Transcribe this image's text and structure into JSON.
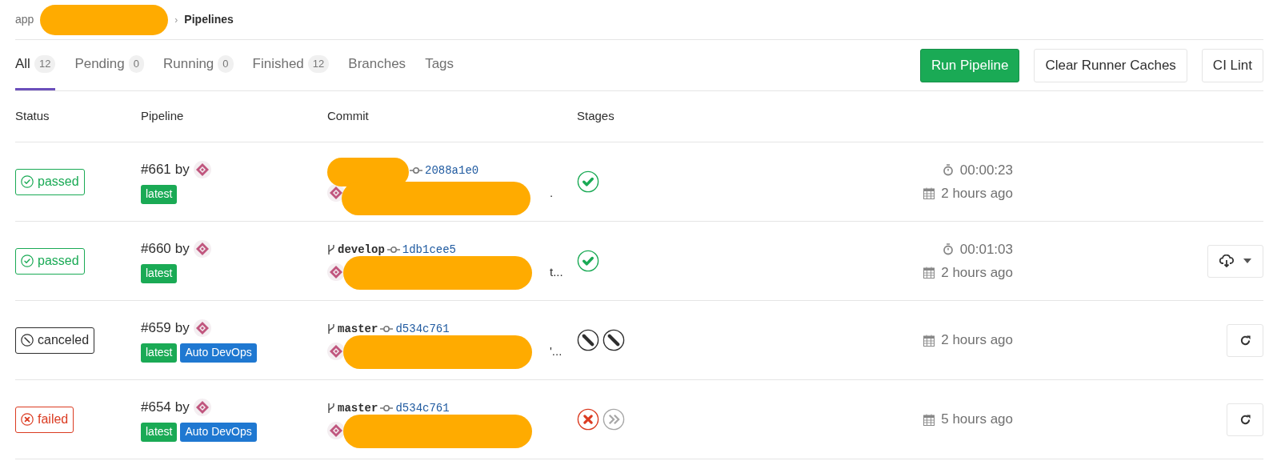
{
  "breadcrumb": {
    "root": "app",
    "separator": "›",
    "current": "Pipelines"
  },
  "tabs": [
    {
      "label": "All",
      "count": "12",
      "selected": true
    },
    {
      "label": "Pending",
      "count": "0",
      "selected": false
    },
    {
      "label": "Running",
      "count": "0",
      "selected": false
    },
    {
      "label": "Finished",
      "count": "12",
      "selected": false
    },
    {
      "label": "Branches",
      "selected": false
    },
    {
      "label": "Tags",
      "selected": false
    }
  ],
  "buttons": [
    {
      "label": "Run Pipeline",
      "kind": "primary"
    },
    {
      "label": "Clear Runner Caches",
      "kind": "default"
    },
    {
      "label": "CI Lint",
      "kind": "default"
    }
  ],
  "table": {
    "columns": [
      "Status",
      "Pipeline",
      "Commit",
      "Stages"
    ],
    "rows": [
      {
        "status": {
          "label": "passed",
          "kind": "passed"
        },
        "pipeline": "#661",
        "by": "by",
        "tags": [
          {
            "label": "latest",
            "color": "#1aaa55"
          }
        ],
        "commit": {
          "sha": "2088a1e0",
          "message_tail": "."
        },
        "stages": [
          {
            "kind": "success"
          }
        ],
        "duration": "00:00:23",
        "finished": "2 hours ago"
      },
      {
        "status": {
          "label": "passed",
          "kind": "passed"
        },
        "pipeline": "#660",
        "by": "by",
        "tags": [
          {
            "label": "latest",
            "color": "#1aaa55"
          }
        ],
        "commit": {
          "branch": "develop",
          "sha": "1db1cee5",
          "message_tail": "t..."
        },
        "stages": [
          {
            "kind": "success"
          }
        ],
        "duration": "00:01:03",
        "finished": "2 hours ago",
        "action": {
          "kind": "download"
        }
      },
      {
        "status": {
          "label": "canceled",
          "kind": "canceled"
        },
        "pipeline": "#659",
        "by": "by",
        "tags": [
          {
            "label": "latest",
            "color": "#1aaa55"
          },
          {
            "label": "Auto DevOps",
            "color": "#1f78d1"
          }
        ],
        "commit": {
          "branch": "master",
          "sha": "d534c761",
          "message_tail": "'..."
        },
        "stages": [
          {
            "kind": "canceled"
          },
          {
            "kind": "canceled"
          }
        ],
        "finished": "2 hours ago",
        "action": {
          "kind": "retry"
        }
      },
      {
        "status": {
          "label": "failed",
          "kind": "failed"
        },
        "pipeline": "#654",
        "by": "by",
        "tags": [
          {
            "label": "latest",
            "color": "#1aaa55"
          },
          {
            "label": "Auto DevOps",
            "color": "#1f78d1"
          }
        ],
        "commit": {
          "branch": "master",
          "sha": "d534c761"
        },
        "stages": [
          {
            "kind": "failed"
          },
          {
            "kind": "skipped"
          }
        ],
        "finished": "5 hours ago",
        "action": {
          "kind": "retry"
        }
      }
    ]
  }
}
